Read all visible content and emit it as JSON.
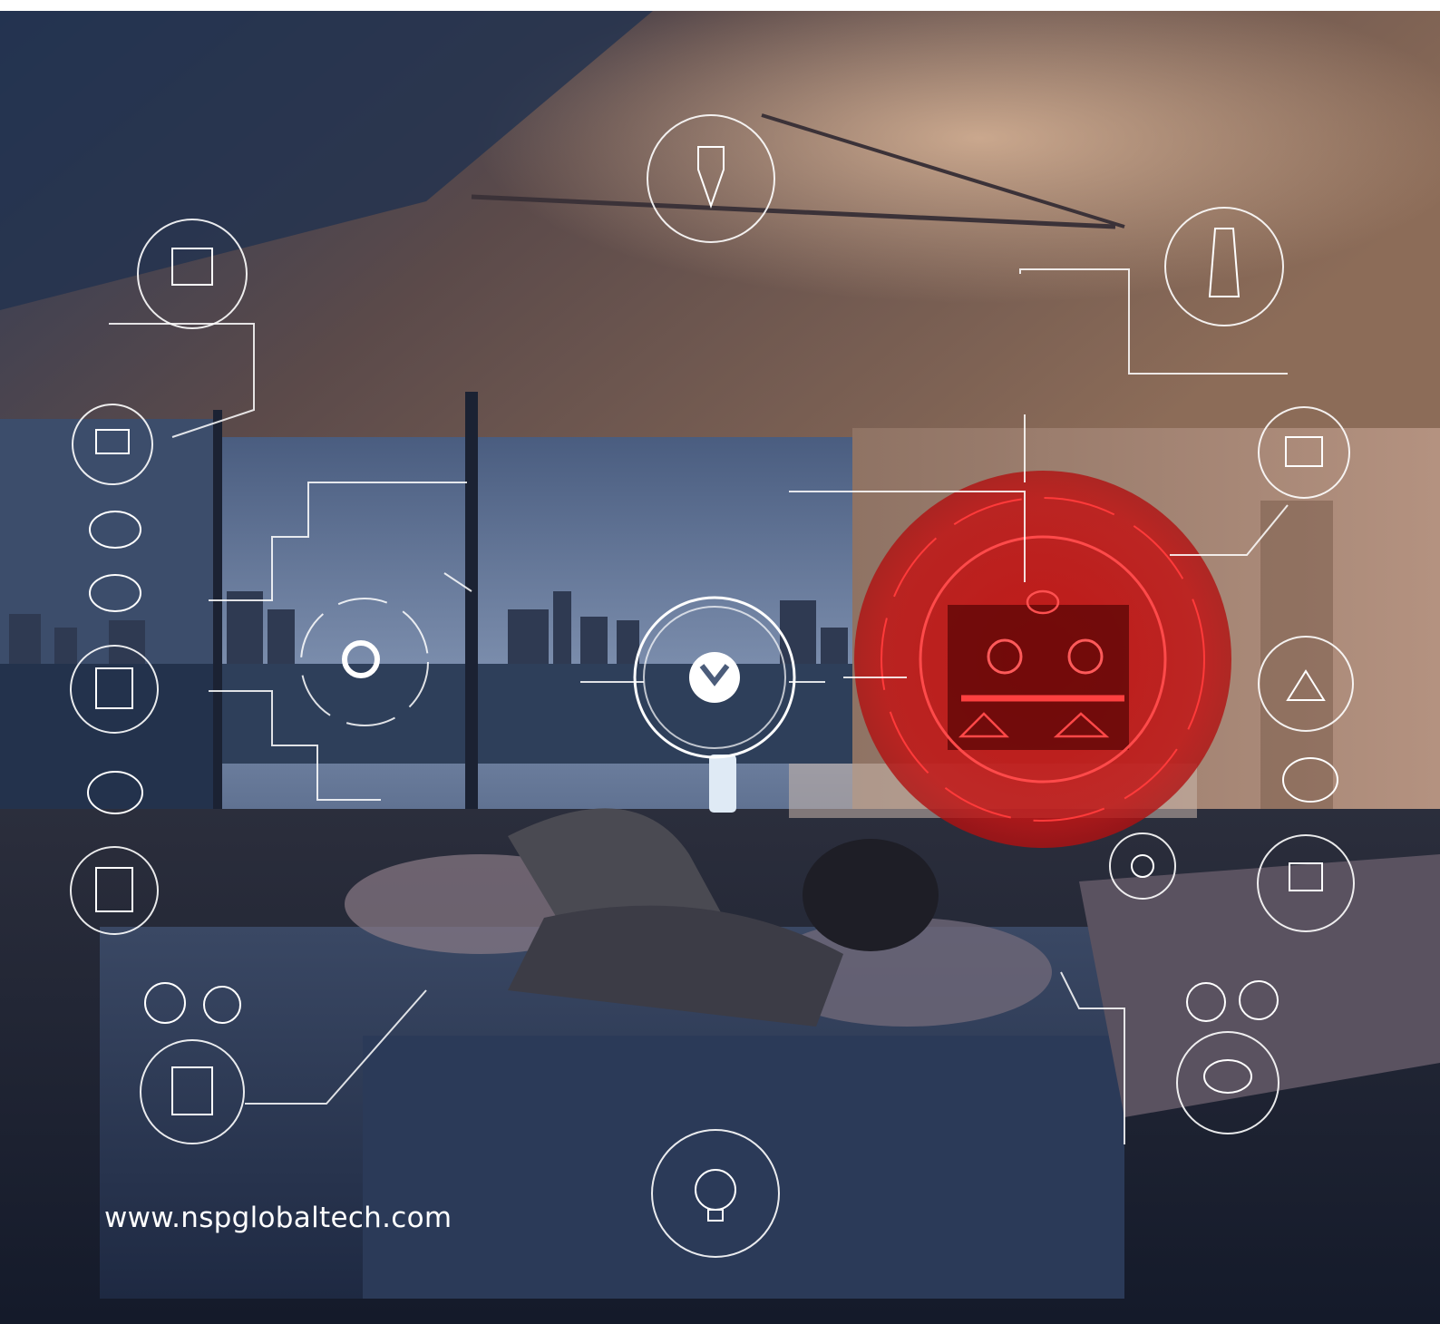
{
  "website_url": "www.nspglobaltech.com",
  "colors": {
    "highlight_red": "#d21414",
    "hud_white": "#ffffff",
    "night_blue": "#1e2e4a",
    "warm_ceiling": "#8a6a55"
  },
  "icons": [
    "camera-icon",
    "thermostat-icon",
    "light-fixture-icon",
    "lamp-icon",
    "tv-icon",
    "robot-icon",
    "speaker-icon",
    "smart-hub-icon",
    "blinds-icon",
    "doorbell-icon",
    "bulb-icon",
    "kitchen-icon"
  ]
}
